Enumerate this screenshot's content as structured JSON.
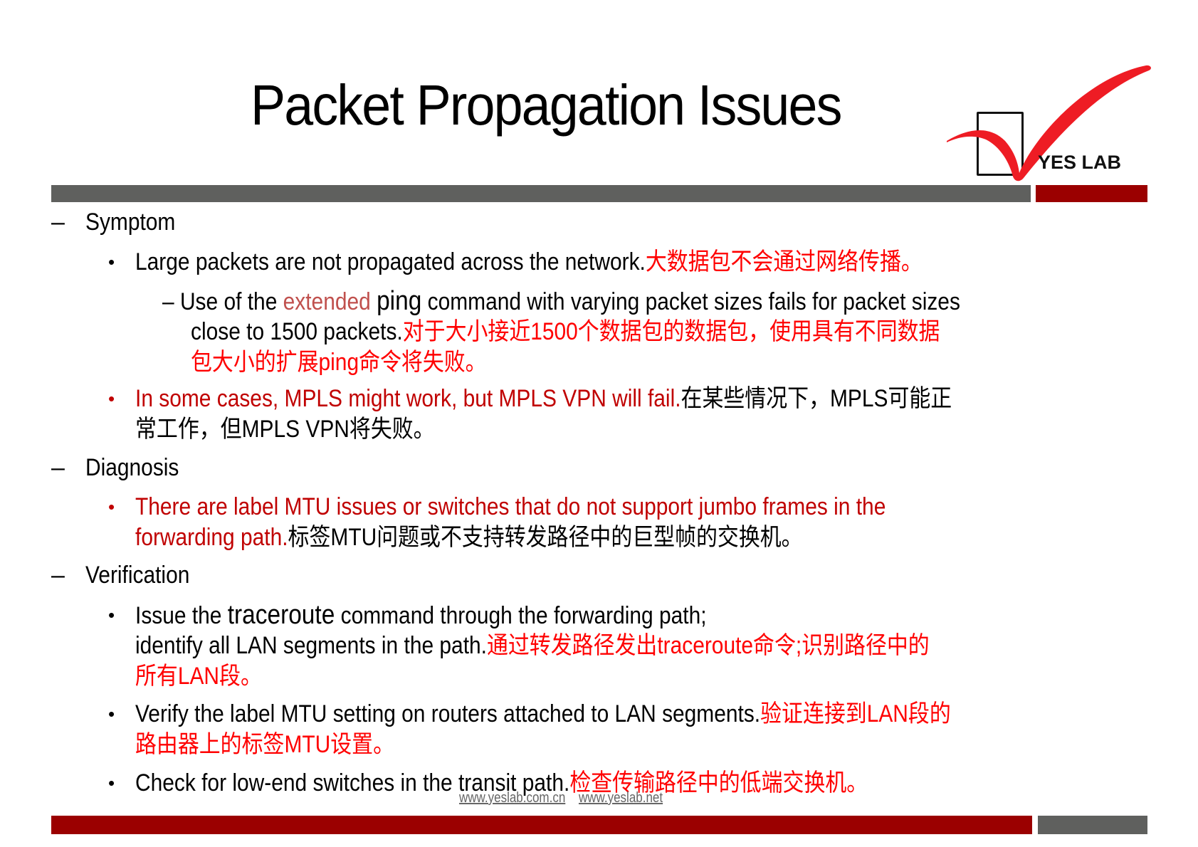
{
  "slide": {
    "title": "Packet Propagation Issues",
    "logo": {
      "icon": "red-checkmark-in-box",
      "text": "YES LAB"
    },
    "colors": {
      "accent_red": "#9b0000",
      "bar_gray": "#5f605e",
      "highlight_red": "#c00000",
      "chinese_red": "#ff0000",
      "extended_word": "#c0504d"
    },
    "sections": [
      {
        "heading": "Symptom",
        "items": [
          {
            "en": "Large packets are not propagated across the network.",
            "cn": "大数据包不会通过网络传播。"
          }
        ],
        "sub": {
          "prefix": "– Use of the ",
          "extended": "extended",
          "ping": "ping",
          "rest": " command with varying packet sizes  fails for packet sizes",
          "line2_en": "close to 1500 packets.",
          "line2_cn": "对于大小接近1500个数据包的数据包，使用具有不同数据",
          "line3_cn": "包大小的扩展ping命令将失败。"
        },
        "item2": {
          "en": "In some cases, MPLS might work, but MPLS  VPN will fail.",
          "cn1": "在某些情况下，MPLS可能正",
          "cn2": "常工作，但MPLS VPN将失败。"
        }
      },
      {
        "heading": "Diagnosis",
        "item": {
          "en1": "There are label MTU issues or switches that do not support jumbo  frames in the",
          "en2": "forwarding path.",
          "cn": "标签MTU问题或不支持转发路径中的巨型帧的交换机。"
        }
      },
      {
        "heading": "Verification",
        "items": [
          {
            "p1": "Issue the ",
            "cmd": "traceroute",
            "p2": "  command through the forwarding path;",
            "line2_en": "identify all LAN segments in the path.",
            "line2_cn": "通过转发路径发出traceroute命令;识别路径中的",
            "line3_cn": "所有LAN段。"
          },
          {
            "en": "Verify the label MTU setting on routers attached to LAN segments.",
            "cn1": "验证连接到LAN段的",
            "cn2": "路由器上的标签MTU设置。"
          },
          {
            "en": "Check for low-end switches in the transit path.",
            "cn": "检查传输路径中的低端交换机。"
          }
        ]
      }
    ],
    "footer": {
      "link1": "www.yeslab.com.cn",
      "link2": "www.yeslab.net"
    }
  }
}
